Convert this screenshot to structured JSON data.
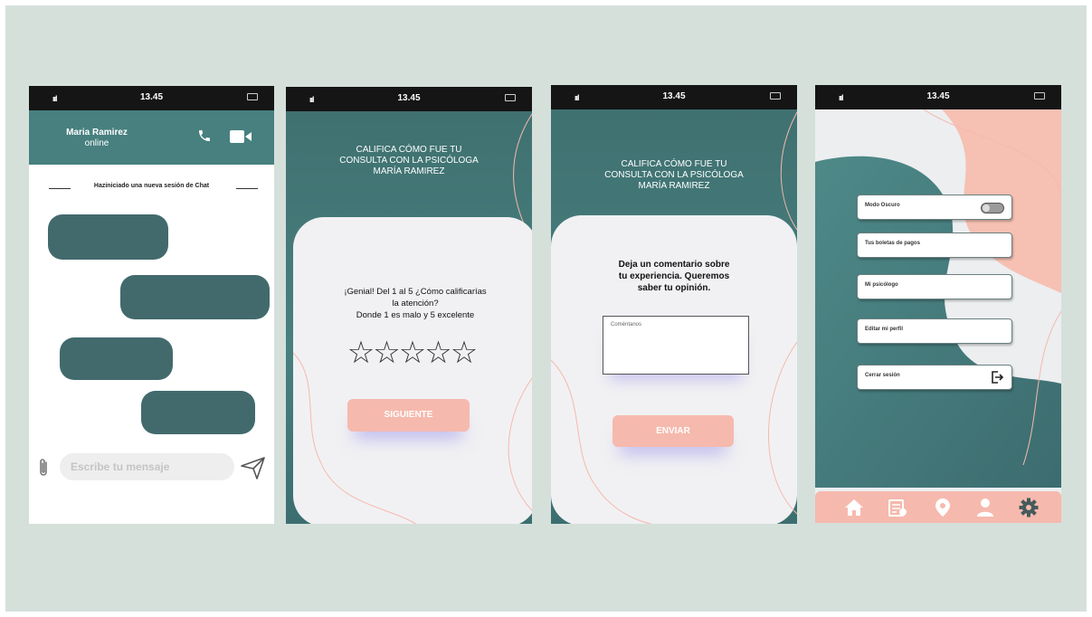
{
  "status_bar": {
    "time": "13.45",
    "signal": "ııl"
  },
  "screen_chat": {
    "contact_name": "Maria Ramirez",
    "contact_status": "online",
    "session_notice": "Haziniciado una nueva sesión de Chat",
    "input_placeholder": "Escribe tu mensaje",
    "icons": [
      "phone-icon",
      "video-call-icon",
      "paperclip-icon",
      "send-icon"
    ]
  },
  "screen_rating": {
    "title_lines": [
      "CALIFICA CÓMO FUE TU",
      "CONSULTA CON LA PSICÓLOGA",
      "MARÍA RAMIREZ"
    ],
    "question_lines": [
      "¡Genial! Del 1 al 5 ¿Cómo calificarías",
      "la atención?",
      "Donde 1 es malo y 5 excelente"
    ],
    "stars": [
      "☆",
      "☆",
      "☆",
      "☆",
      "☆"
    ],
    "rating_value": 0,
    "button_label": "SIGUIENTE"
  },
  "screen_comment": {
    "title_lines": [
      "CALIFICA CÓMO FUE TU",
      "CONSULTA CON LA PSICÓLOGA",
      "MARÍA RAMIREZ"
    ],
    "prompt_lines": [
      "Deja un comentario sobre",
      "tu experiencia. Queremos",
      "saber tu opinión."
    ],
    "comment_placeholder": "Coméntanos",
    "button_label": "ENVIAR"
  },
  "screen_settings": {
    "menu": [
      {
        "label": "Modo Oscuro",
        "control": "toggle",
        "toggle_on": false
      },
      {
        "label": "Tus boletas de pagos"
      },
      {
        "label": "Mi psicólogo"
      },
      {
        "label": "Editar mi perfil"
      },
      {
        "label": "Cerrar sesión",
        "control": "logout-icon"
      }
    ],
    "bottom_nav": [
      "home-icon",
      "receipt-icon",
      "location-pin-icon",
      "user-icon",
      "gear-icon"
    ]
  },
  "colors": {
    "background": "#d5e0db",
    "teal": "#47807f",
    "dark_teal": "#426a6d",
    "peach": "#f6b9ad",
    "card": "#f1f1f3",
    "status_bar": "#151515"
  }
}
